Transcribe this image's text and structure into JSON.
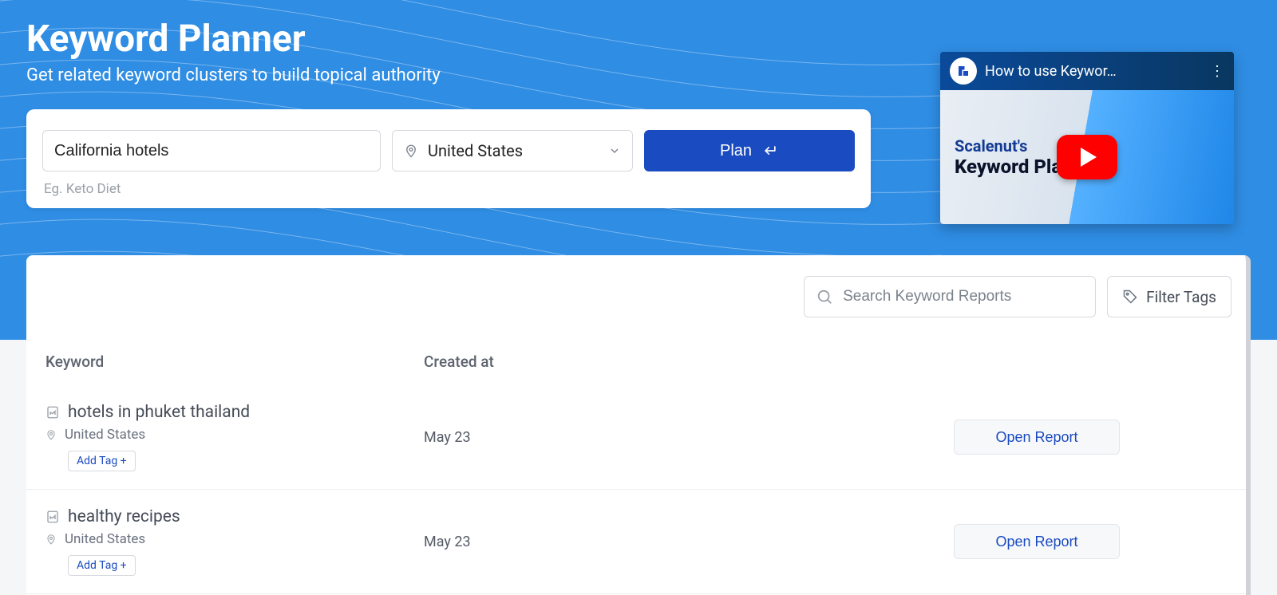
{
  "header": {
    "title": "Keyword Planner",
    "subtitle": "Get related keyword clusters to build topical authority"
  },
  "search": {
    "keyword_value": "California hotels",
    "example_hint": "Eg. Keto Diet",
    "country_selected": "United States",
    "plan_button_label": "Plan"
  },
  "video": {
    "title": "How to use Keywor…",
    "thumb_line1": "Scalenut's",
    "thumb_line2": "Keyword Planner"
  },
  "reports_toolbar": {
    "search_placeholder": "Search Keyword Reports",
    "filter_tags_label": "Filter Tags"
  },
  "table": {
    "columns": {
      "keyword": "Keyword",
      "created_at": "Created at"
    },
    "open_report_label": "Open Report",
    "add_tag_label": "Add Tag +",
    "rows": [
      {
        "keyword": "hotels in phuket thailand",
        "location": "United States",
        "created_at": "May 23"
      },
      {
        "keyword": "healthy recipes",
        "location": "United States",
        "created_at": "May 23"
      }
    ]
  }
}
